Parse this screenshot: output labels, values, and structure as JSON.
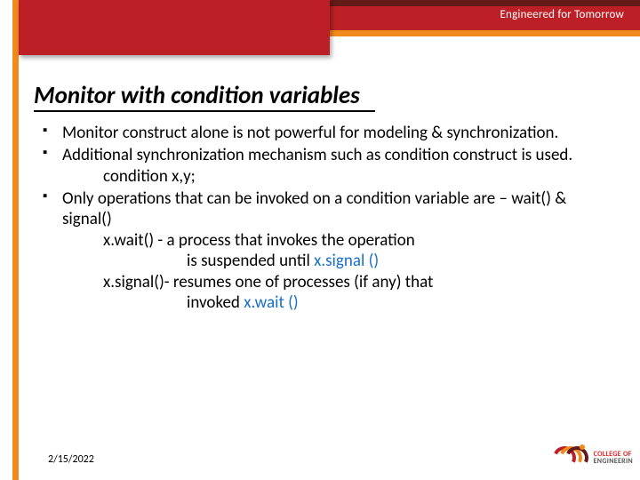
{
  "header": {
    "tagline": "Engineered for Tomorrow"
  },
  "title": "Monitor with condition variables",
  "bullets": {
    "b1": "Monitor construct alone is not powerful for modeling & synchronization.",
    "b2a": "Additional synchronization mechanism such as condition construct is used.",
    "b2b": "condition x,y;",
    "b3a": "Only operations that can be invoked on a condition variable are – wait() & signal()",
    "b3b": "x.wait() - a process that invokes the operation",
    "b3c_pre": "is suspended until ",
    "b3c_link": "x.signal ()",
    "b3d": "x.signal()- resumes one of processes (if any) that",
    "b3e_pre": "invoked ",
    "b3e_link": "x.wait ()"
  },
  "footer": {
    "date": "2/15/2022",
    "logo_l1": "COLLEGE OF",
    "logo_l2": "ENGINEERIN"
  }
}
